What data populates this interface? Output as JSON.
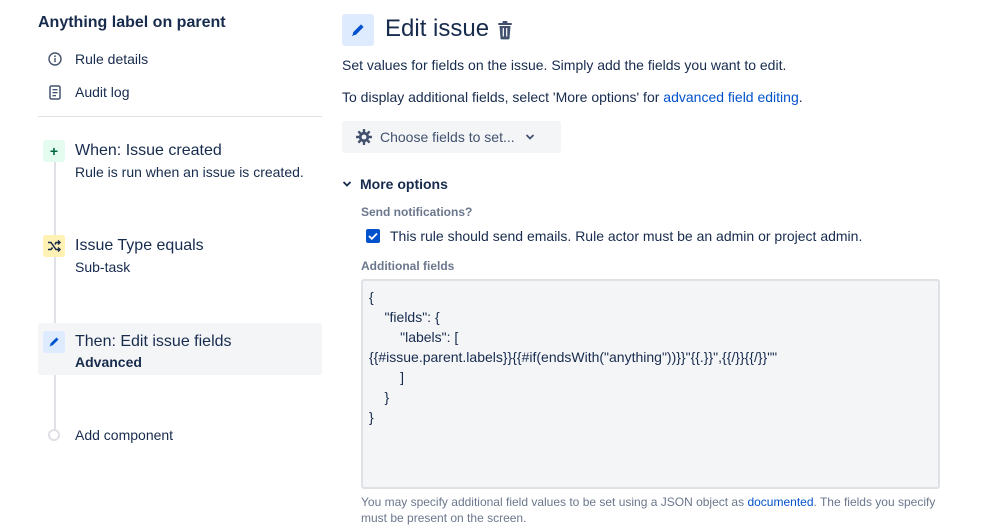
{
  "sidebar": {
    "rule_title": "Anything label on parent",
    "nav": [
      {
        "label": "Rule details",
        "icon": "info-icon"
      },
      {
        "label": "Audit log",
        "icon": "document-icon"
      }
    ],
    "steps": [
      {
        "title": "When: Issue created",
        "subtitle": "Rule is run when an issue is created.",
        "icon": "plus-icon"
      },
      {
        "title": "Issue Type equals",
        "subtitle": "Sub-task",
        "icon": "shuffle-icon"
      },
      {
        "title": "Then: Edit issue fields",
        "subtitle": "Advanced",
        "icon": "pencil-icon"
      }
    ],
    "add_component": "Add component"
  },
  "main": {
    "title": "Edit issue",
    "description": "Set values for fields on the issue. Simply add the fields you want to edit.",
    "additional_prefix": "To display additional fields, select 'More options' for ",
    "additional_link": "advanced field editing",
    "additional_suffix": ".",
    "choose_fields": "Choose fields to set...",
    "more_options": "More options",
    "notifications_label": "Send notifications?",
    "notifications_checkbox": "This rule should send emails. Rule actor must be an admin or project admin.",
    "additional_fields_label": "Additional fields",
    "additional_fields_value": "{\n    \"fields\": {\n        \"labels\": [\n{{#issue.parent.labels}}{{#if(endsWith(\"anything\"))}}\"{{.}}\",{{/}}{{/}}\"\"\n        ]\n    }\n}",
    "help_prefix": "You may specify additional field values to be set using a JSON object as ",
    "help_link": "documented",
    "help_suffix": ". The fields you specify must be present on the screen."
  },
  "colors": {
    "primary": "#0052cc",
    "text": "#172b4d",
    "subtle": "#6b778c",
    "trigger_bg": "#e3fcef",
    "condition_bg": "#fff0b3",
    "action_bg": "#deebff"
  }
}
